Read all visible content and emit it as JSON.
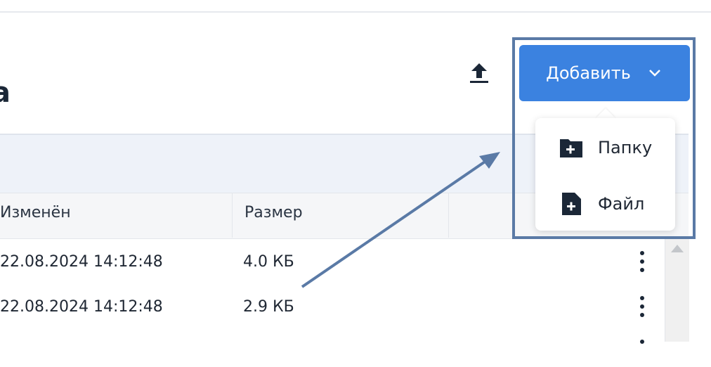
{
  "page": {
    "title_fragment": "а"
  },
  "toolbar": {
    "upload_icon": "upload-icon",
    "add_label": "Добавить",
    "add_chevron_icon": "chevron-down-icon"
  },
  "add_menu": {
    "items": [
      {
        "label": "Папку",
        "icon": "folder-plus-icon"
      },
      {
        "label": "Файл",
        "icon": "file-plus-icon"
      }
    ]
  },
  "table": {
    "columns": [
      "Изменён",
      "Размер"
    ],
    "rows": [
      {
        "modified": "22.08.2024 14:12:48",
        "size": "4.0 КБ"
      },
      {
        "modified": "22.08.2024 14:12:48",
        "size": "2.9 КБ"
      }
    ]
  },
  "colors": {
    "accent": "#3b82e0",
    "highlight_border": "#5a7aa6",
    "icon_dark": "#1b2737"
  }
}
